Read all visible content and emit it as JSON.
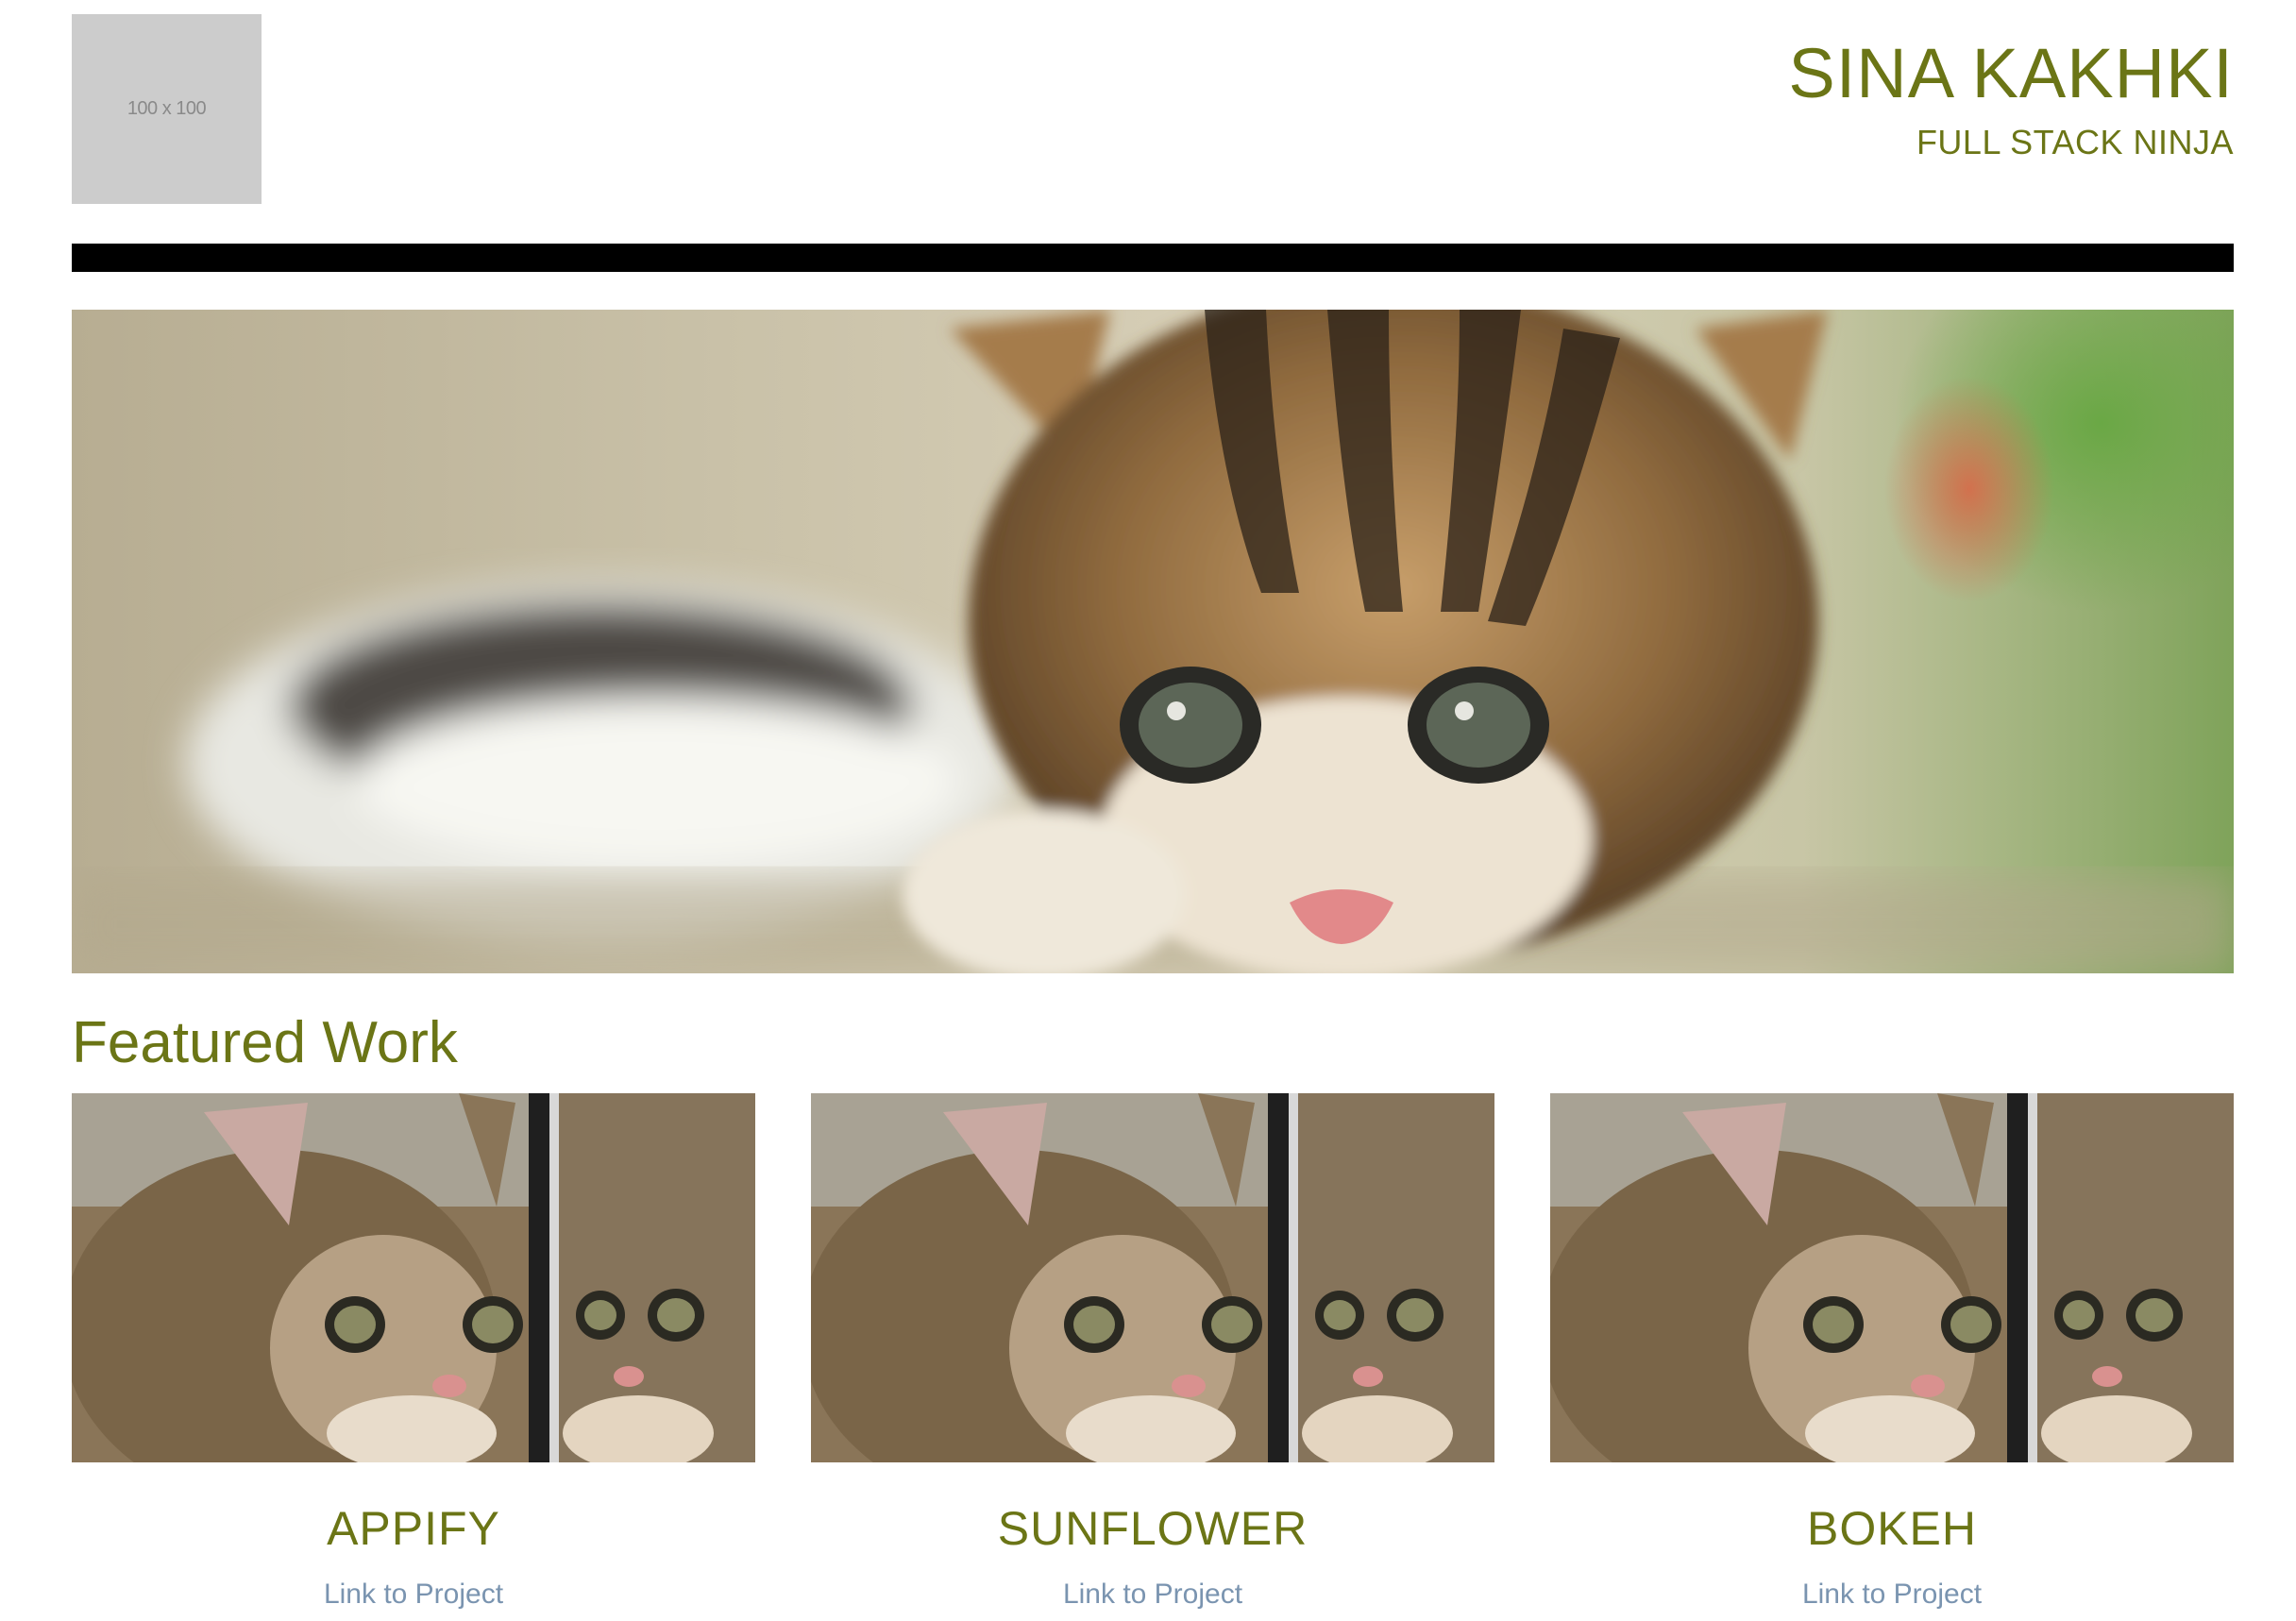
{
  "header": {
    "logo_placeholder": "100 x 100",
    "name": "SINA KAKHKI",
    "tagline": "FULL STACK NINJA"
  },
  "hero": {
    "image": "kitten-hero-photo"
  },
  "featured": {
    "title": "Featured Work",
    "projects": [
      {
        "title": "APPIFY",
        "link_label": "Link to Project",
        "image": "kitten-mirror-photo"
      },
      {
        "title": "SUNFLOWER",
        "link_label": "Link to Project",
        "image": "kitten-mirror-photo"
      },
      {
        "title": "BOKEH",
        "link_label": "Link to Project",
        "image": "kitten-mirror-photo"
      }
    ]
  },
  "colors": {
    "accent": "#6b7516",
    "link": "#7a94b0",
    "divider": "#000000",
    "placeholder": "#cccccc"
  }
}
